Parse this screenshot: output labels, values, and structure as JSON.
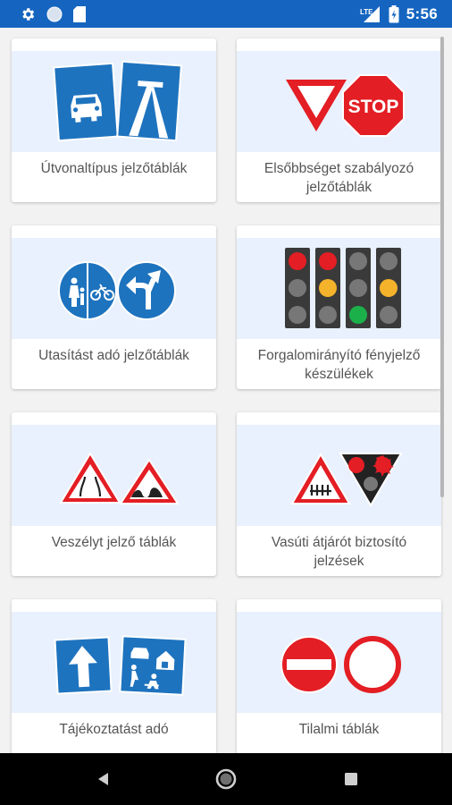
{
  "status_bar": {
    "time": "5:56",
    "network": "LTE",
    "icons": [
      "settings-icon",
      "circle-icon",
      "sd-card-icon",
      "signal-icon",
      "battery-icon"
    ]
  },
  "cards": [
    {
      "label": "Útvonaltípus jelzőtáblák"
    },
    {
      "label": "Elsőbbséget szabályozó jelzőtáblák"
    },
    {
      "label": "Utasítást adó jelzőtáblák"
    },
    {
      "label": "Forgalomirányító fényjelző készülékek"
    },
    {
      "label": "Veszélyt jelző táblák"
    },
    {
      "label": "Vasúti átjárót biztosító jelzések"
    },
    {
      "label": "Tájékoztatást adó"
    },
    {
      "label": "Tilalmi táblák"
    }
  ],
  "sign_texts": {
    "stop": "STOP"
  },
  "colors": {
    "status_bar": "#1565c0",
    "card_image_bg": "#e8f1fd",
    "sign_blue": "#1e73be",
    "sign_red": "#e31e24"
  },
  "navigation_bar": {
    "icons": [
      "back-icon",
      "home-icon",
      "recents-icon"
    ]
  }
}
